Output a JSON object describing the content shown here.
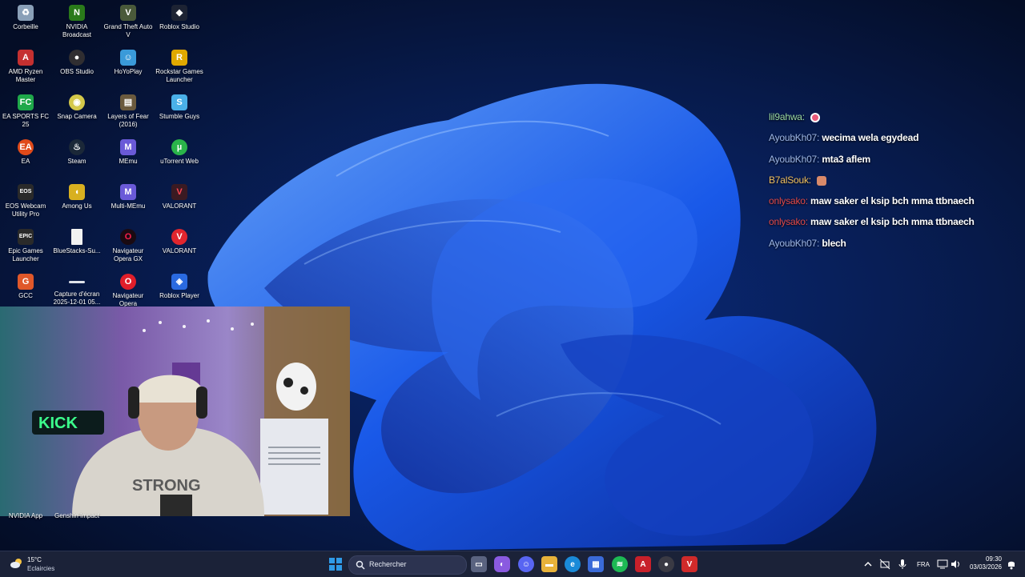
{
  "desktop_icons": [
    {
      "label": "Corbeille",
      "icon": "recycle-bin-icon",
      "color": "#8aa0b8"
    },
    {
      "label": "NVIDIA Broadcast",
      "icon": "nvidia-broadcast-icon",
      "color": "#2a7a1a"
    },
    {
      "label": "Grand Theft Auto V",
      "icon": "gta-v-icon",
      "color": "#4a5a3a"
    },
    {
      "label": "Roblox Studio",
      "icon": "roblox-studio-icon",
      "color": "#1d2333"
    },
    {
      "label": "AMD Ryzen Master",
      "icon": "amd-ryzen-master-icon",
      "color": "#c53030"
    },
    {
      "label": "OBS Studio",
      "icon": "obs-studio-icon",
      "color": "#302e31"
    },
    {
      "label": "HoYoPlay",
      "icon": "hoyoplay-icon",
      "color": "#3a9ad9"
    },
    {
      "label": "Rockstar Games Launcher",
      "icon": "rockstar-icon",
      "color": "#e0a800"
    },
    {
      "label": "EA SPORTS FC 25",
      "icon": "ea-fc-icon",
      "color": "#1fa84a"
    },
    {
      "label": "Snap Camera",
      "icon": "snap-camera-icon",
      "color": "#d4c84a"
    },
    {
      "label": "Layers of Fear (2016)",
      "icon": "layers-of-fear-icon",
      "color": "#6b5a3e"
    },
    {
      "label": "Stumble Guys",
      "icon": "stumble-guys-icon",
      "color": "#4ab0e8"
    },
    {
      "label": "EA",
      "icon": "ea-icon",
      "color": "#e04a1a"
    },
    {
      "label": "Steam",
      "icon": "steam-icon",
      "color": "#1b2838"
    },
    {
      "label": "MEmu",
      "icon": "memu-icon",
      "color": "#6a5ad8"
    },
    {
      "label": "uTorrent Web",
      "icon": "utorrent-icon",
      "color": "#2ab34a"
    },
    {
      "label": "EOS Webcam Utility Pro",
      "icon": "eos-webcam-icon",
      "color": "#2a2a2a"
    },
    {
      "label": "Among Us",
      "icon": "among-us-icon",
      "color": "#d8b020"
    },
    {
      "label": "Multi-MEmu",
      "icon": "multi-memu-icon",
      "color": "#6a5ad8"
    },
    {
      "label": "VALORANT",
      "icon": "valorant-icon",
      "color": "#3a1a22"
    },
    {
      "label": "Epic Games Launcher",
      "icon": "epic-games-icon",
      "color": "#2a2a2a"
    },
    {
      "label": "BlueStacks-Su...",
      "icon": "file-icon",
      "color": "#f2f2f2"
    },
    {
      "label": "Navigateur Opera GX",
      "icon": "opera-gx-icon",
      "color": "#1a0a12"
    },
    {
      "label": "VALORANT",
      "icon": "valorant-red-icon",
      "color": "#e0262e"
    },
    {
      "label": "GCC",
      "icon": "gcc-icon",
      "color": "#e0582a"
    },
    {
      "label": "Capture d'écran 2025-12-01 05...",
      "icon": "screenshot-file-icon",
      "color": "#dfe3ea"
    },
    {
      "label": "Navigateur Opera",
      "icon": "opera-icon",
      "color": "#e01e2a"
    },
    {
      "label": "Roblox Player",
      "icon": "roblox-player-icon",
      "color": "#2a6ae0"
    }
  ],
  "bottom_icons": [
    {
      "label": "NVIDIA App"
    },
    {
      "label": "Genshin Impact"
    }
  ],
  "chat": [
    {
      "user": "lil9ahwa:",
      "user_color": "#9ad8a0",
      "message": "",
      "emote": "#e85a7a"
    },
    {
      "user": "AyoubKh07:",
      "user_color": "#9db6e6",
      "message": "wecima wela egydead"
    },
    {
      "user": "AyoubKh07:",
      "user_color": "#9db6e6",
      "message": "mta3 aflem"
    },
    {
      "user": "B7alSouk:",
      "user_color": "#f0c060",
      "message": "",
      "emote": "#d98a6a"
    },
    {
      "user": "onlysako:",
      "user_color": "#e04848",
      "message": "maw saker el ksip bch mma ttbnaech"
    },
    {
      "user": "onlysako:",
      "user_color": "#e04848",
      "message": "maw saker el ksip bch mma ttbnaech"
    },
    {
      "user": "AyoubKh07:",
      "user_color": "#9db6e6",
      "message": "blech"
    }
  ],
  "taskbar": {
    "weather_temp": "15°C",
    "weather_cond": "Eclaircies",
    "search_placeholder": "Rechercher",
    "apps": [
      {
        "name": "windows-start-icon",
        "color": "#2f8de0"
      },
      {
        "name": "task-view-icon",
        "color": "#5a6380"
      },
      {
        "name": "copilot-icon",
        "color": "#8a5ae0"
      },
      {
        "name": "discord-icon",
        "color": "#5865f2"
      },
      {
        "name": "file-explorer-icon",
        "color": "#e8b23a"
      },
      {
        "name": "edge-icon",
        "color": "#1a8ad8"
      },
      {
        "name": "microsoft-store-icon",
        "color": "#3a6ad8"
      },
      {
        "name": "spotify-icon",
        "color": "#1db954"
      },
      {
        "name": "adobe-icon",
        "color": "#c8202a"
      },
      {
        "name": "obs-taskbar-icon",
        "color": "#3a3a44"
      },
      {
        "name": "valorant-taskbar-icon",
        "color": "#d02a2a"
      }
    ],
    "language": "FRA",
    "time": "09:30",
    "date": "03/03/2026"
  }
}
